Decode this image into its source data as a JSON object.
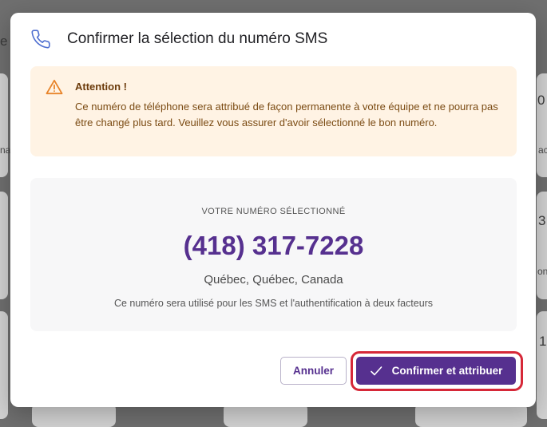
{
  "background": {
    "fragments": [
      "e",
      "0",
      "na",
      "ac",
      "3",
      "on",
      "1"
    ]
  },
  "dialog": {
    "title": "Confirmer la sélection du numéro SMS",
    "icon": "phone-icon",
    "warning": {
      "icon": "warning-triangle-icon",
      "title": "Attention !",
      "message": "Ce numéro de téléphone sera attribué de façon permanente à votre équipe et ne pourra pas être changé plus tard. Veuillez vous assurer d'avoir sélectionné le bon numéro."
    },
    "selected": {
      "label": "VOTRE NUMÉRO SÉLECTIONNÉ",
      "number": "(418) 317-7228",
      "location": "Québec, Québec, Canada",
      "note": "Ce numéro sera utilisé pour les SMS et l'authentification à deux facteurs"
    },
    "buttons": {
      "cancel_label": "Annuler",
      "confirm_label": "Confirmer et attribuer",
      "confirm_icon": "check-icon"
    }
  },
  "colors": {
    "accent": "#56308f",
    "warning_bg": "#fff3e4",
    "warning_icon": "#e8842a",
    "highlight": "#d62838"
  }
}
